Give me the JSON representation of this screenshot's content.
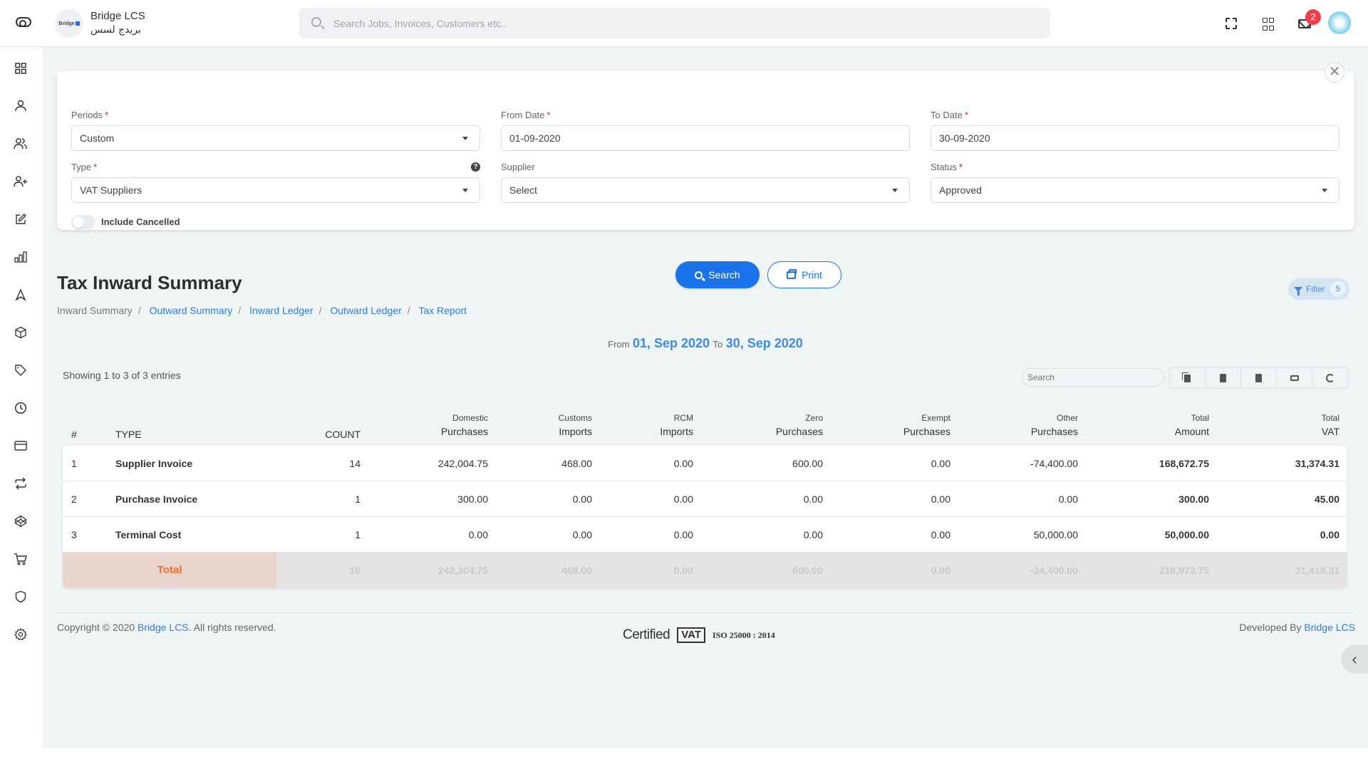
{
  "header": {
    "brand_name": "Bridge LCS",
    "brand_name_ar": "بريدج لسس",
    "logo_text": "Bridge",
    "search_placeholder": "Search Jobs, Invoices, Customers etc..",
    "mail_badge_count": "2"
  },
  "sidebar": {
    "items": [
      {
        "name": "dashboard",
        "icon": "grid-icon"
      },
      {
        "name": "user",
        "icon": "user-icon"
      },
      {
        "name": "users",
        "icon": "users-icon"
      },
      {
        "name": "add-user",
        "icon": "user-plus-icon"
      },
      {
        "name": "edit",
        "icon": "edit-icon"
      },
      {
        "name": "reports",
        "icon": "bar-chart-icon"
      },
      {
        "name": "navigation",
        "icon": "navigation-icon"
      },
      {
        "name": "packages",
        "icon": "box-icon"
      },
      {
        "name": "tags",
        "icon": "tag-icon"
      },
      {
        "name": "history",
        "icon": "clock-icon"
      },
      {
        "name": "payments",
        "icon": "credit-card-icon"
      },
      {
        "name": "transfers",
        "icon": "repeat-icon"
      },
      {
        "name": "integrations",
        "icon": "codepen-icon"
      },
      {
        "name": "purchases",
        "icon": "cart-icon"
      },
      {
        "name": "security",
        "icon": "shield-icon"
      },
      {
        "name": "settings",
        "icon": "gear-icon"
      }
    ]
  },
  "filters": {
    "periods": {
      "label": "Periods",
      "value": "Custom"
    },
    "from_date": {
      "label": "From Date",
      "value": "01-09-2020"
    },
    "to_date": {
      "label": "To Date",
      "value": "30-09-2020"
    },
    "type": {
      "label": "Type",
      "value": "VAT Suppliers"
    },
    "supplier": {
      "label": "Supplier",
      "value": "Select"
    },
    "status": {
      "label": "Status",
      "value": "Approved"
    },
    "include_cancelled": {
      "label": "Include Cancelled",
      "checked": false
    },
    "required_mark": "*",
    "help_glyph": "?",
    "close_glyph": "✕",
    "search_label": "Search",
    "print_label": "Print"
  },
  "page": {
    "title": "Tax Inward Summary",
    "filter_pill_label": "Filter",
    "filter_pill_count": "5",
    "breadcrumb": [
      {
        "label": "Inward Summary",
        "link": false
      },
      {
        "label": "Outward Summary",
        "link": true
      },
      {
        "label": "Inward Ledger",
        "link": true
      },
      {
        "label": "Outward Ledger",
        "link": true
      },
      {
        "label": "Tax Report",
        "link": true
      }
    ],
    "breadcrumb_sep": "/",
    "range_from_label": "From",
    "range_from": "01, Sep 2020",
    "range_to_label": "To",
    "range_to": "30, Sep 2020"
  },
  "table": {
    "showing": "Showing 1 to 3 of 3 entries",
    "search_placeholder": "Search",
    "tools": [
      "copy",
      "csv",
      "excel",
      "print",
      "refresh"
    ],
    "columns": [
      {
        "l1": "",
        "l2": "#"
      },
      {
        "l1": "",
        "l2": "TYPE"
      },
      {
        "l1": "",
        "l2": "COUNT"
      },
      {
        "l1": "Domestic",
        "l2": "Purchases"
      },
      {
        "l1": "Customs",
        "l2": "Imports"
      },
      {
        "l1": "RCM",
        "l2": "Imports"
      },
      {
        "l1": "Zero",
        "l2": "Purchases"
      },
      {
        "l1": "Exempt",
        "l2": "Purchases"
      },
      {
        "l1": "Other",
        "l2": "Purchases"
      },
      {
        "l1": "Total",
        "l2": "Amount"
      },
      {
        "l1": "Total",
        "l2": "VAT"
      }
    ],
    "rows": [
      {
        "idx": "1",
        "type": "Supplier Invoice",
        "count": "14",
        "domestic": "242,004.75",
        "customs": "468.00",
        "rcm": "0.00",
        "zero": "600.00",
        "exempt": "0.00",
        "other": "-74,400.00",
        "total_amount": "168,672.75",
        "total_vat": "31,374.31"
      },
      {
        "idx": "2",
        "type": "Purchase Invoice",
        "count": "1",
        "domestic": "300.00",
        "customs": "0.00",
        "rcm": "0.00",
        "zero": "0.00",
        "exempt": "0.00",
        "other": "0.00",
        "total_amount": "300.00",
        "total_vat": "45.00"
      },
      {
        "idx": "3",
        "type": "Terminal Cost",
        "count": "1",
        "domestic": "0.00",
        "customs": "0.00",
        "rcm": "0.00",
        "zero": "0.00",
        "exempt": "0.00",
        "other": "50,000.00",
        "total_amount": "50,000.00",
        "total_vat": "0.00"
      }
    ],
    "total": {
      "label": "Total",
      "count": "16",
      "domestic": "242,304.75",
      "customs": "468.00",
      "rcm": "0.00",
      "zero": "600.00",
      "exempt": "0.00",
      "other": "-24,400.00",
      "total_amount": "218,972.75",
      "total_vat": "31,419.31"
    }
  },
  "footer": {
    "copyright_prefix": "Copyright © 2020 ",
    "copyright_link": "Bridge LCS",
    "copyright_suffix": ". All rights reserved.",
    "developed_by": "Developed By ",
    "developed_link": "Bridge LCS",
    "cert_certified": "Certified",
    "cert_vat": "VAT",
    "cert_iso": "ISO 25000 : 2014"
  },
  "colors": {
    "accent": "#1a73e8",
    "link": "#2d7ee0",
    "badge": "#ef3e4a",
    "total_label": "#f06f2a",
    "total_label_bg": "#e9d5cd",
    "page_bg": "#eff4f4"
  }
}
